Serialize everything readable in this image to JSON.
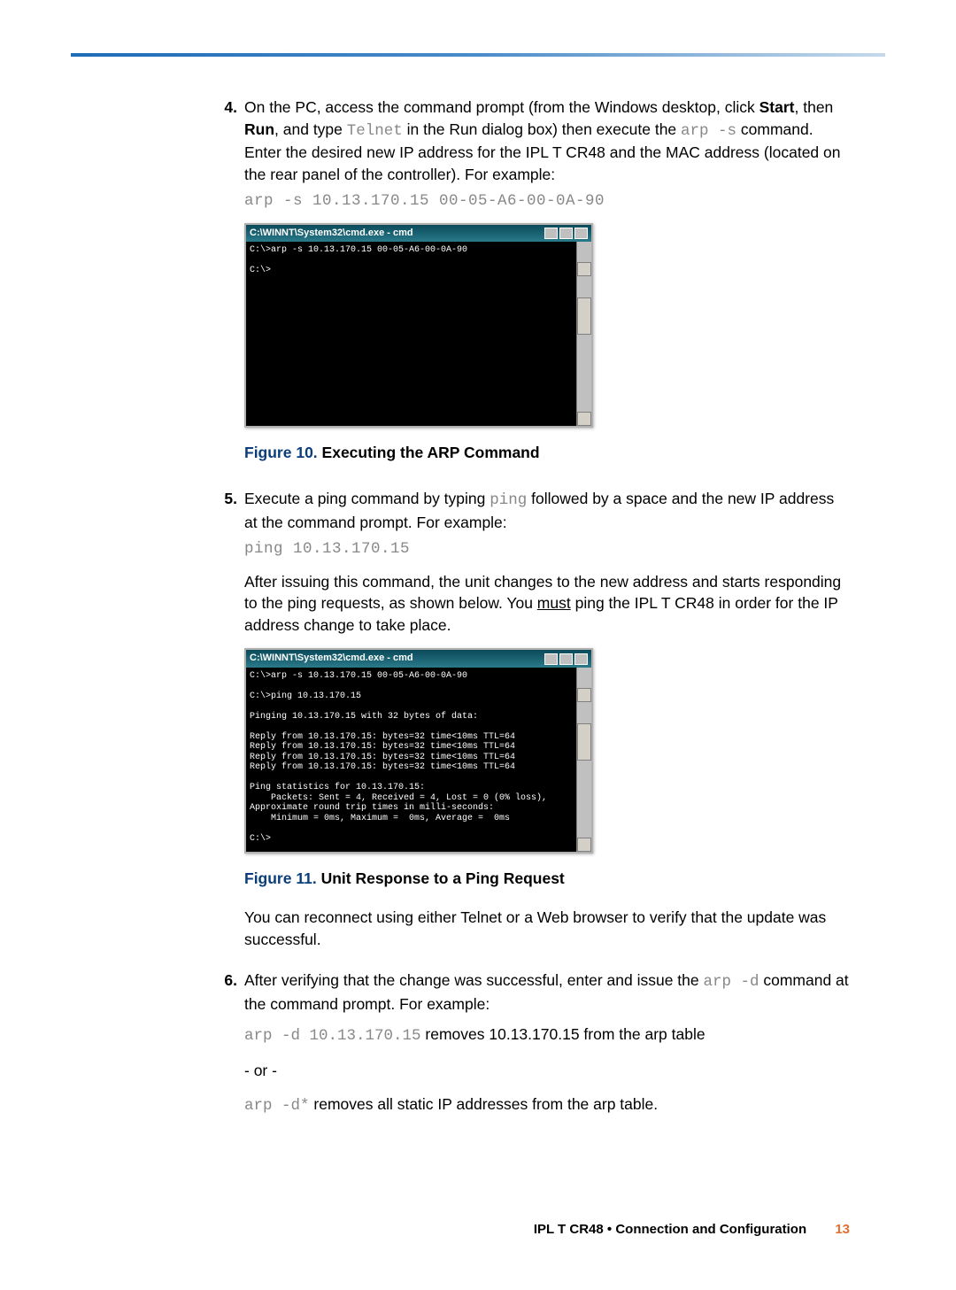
{
  "step4": {
    "num": "4.",
    "text_before_start": "On the PC, access the command prompt (from the Windows desktop, click ",
    "start": "Start",
    "text_mid1": ", then ",
    "run": "Run",
    "text_mid2": ", and type ",
    "telnet": "Telnet",
    "text_mid3": " in the Run dialog box) then execute the ",
    "arps": "arp -s",
    "text_after": " command. Enter the desired new IP address for the IPL T CR48 and the MAC address (located on the rear panel of the controller). For example:",
    "code": "arp -s 10.13.170.15 00-05-A6-00-0A-90"
  },
  "cmdwin1": {
    "title": "C:\\WINNT\\System32\\cmd.exe - cmd",
    "body": "C:\\>arp -s 10.13.170.15 00-05-A6-00-0A-90\n\nC:\\>"
  },
  "fig10": {
    "label": "Figure 10.",
    "title": "Executing the ARP Command"
  },
  "step5": {
    "num": "5.",
    "text_before": "Execute a ping command by typing ",
    "ping": "ping",
    "text_after": " followed by a space and the new IP address at the command prompt. For example:",
    "code": "ping 10.13.170.15",
    "para_before": "After issuing this command, the unit changes to the new address and starts responding to the ping requests, as shown below. You ",
    "must": "must",
    "para_after": " ping the IPL T CR48 in order for the IP address change to take place."
  },
  "cmdwin2": {
    "title": "C:\\WINNT\\System32\\cmd.exe - cmd",
    "body": "C:\\>arp -s 10.13.170.15 00-05-A6-00-0A-90\n\nC:\\>ping 10.13.170.15\n\nPinging 10.13.170.15 with 32 bytes of data:\n\nReply from 10.13.170.15: bytes=32 time<10ms TTL=64\nReply from 10.13.170.15: bytes=32 time<10ms TTL=64\nReply from 10.13.170.15: bytes=32 time<10ms TTL=64\nReply from 10.13.170.15: bytes=32 time<10ms TTL=64\n\nPing statistics for 10.13.170.15:\n    Packets: Sent = 4, Received = 4, Lost = 0 (0% loss),\nApproximate round trip times in milli-seconds:\n    Minimum = 0ms, Maximum =  0ms, Average =  0ms\n\nC:\\>"
  },
  "fig11": {
    "label": "Figure 11.",
    "title": "Unit Response to a Ping Request"
  },
  "post5": "You can reconnect using either Telnet or a Web browser to verify that the update was successful.",
  "step6": {
    "num": "6.",
    "text_before": "After verifying that the change was successful, enter and issue the ",
    "arpd": "arp -d",
    "text_after": " command at the command prompt. For example:",
    "line1_code": "arp -d 10.13.170.15",
    "line1_text": " removes 10.13.170.15 from the arp table",
    "or": "- or -",
    "line2_code": "arp -d*",
    "line2_text": " removes all static IP addresses from the arp table."
  },
  "footer": {
    "doc": "IPL T CR48 • Connection and Configuration",
    "page": "13"
  }
}
